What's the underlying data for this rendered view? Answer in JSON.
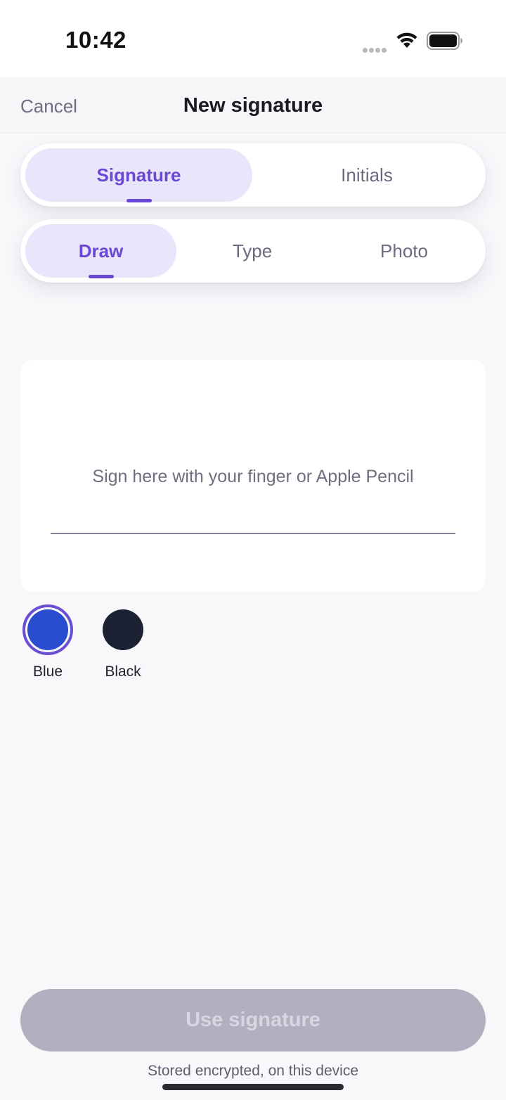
{
  "status_bar": {
    "time": "10:42",
    "icons": [
      "signal-icon",
      "wifi-icon",
      "battery-icon"
    ]
  },
  "nav": {
    "cancel_label": "Cancel",
    "title": "New signature"
  },
  "kind_tabs": {
    "items": [
      {
        "label": "Signature",
        "selected": true
      },
      {
        "label": "Initials",
        "selected": false
      }
    ]
  },
  "method_tabs": {
    "items": [
      {
        "label": "Draw",
        "selected": true
      },
      {
        "label": "Type",
        "selected": false
      },
      {
        "label": "Photo",
        "selected": false
      }
    ]
  },
  "sign_pad": {
    "hint": "Sign here with your finger or Apple Pencil"
  },
  "ink_colors": {
    "items": [
      {
        "label": "Blue",
        "color": "#2a4dd0",
        "selected": true
      },
      {
        "label": "Black",
        "color": "#1c2233",
        "selected": false
      }
    ]
  },
  "actions": {
    "use_label": "Use signature",
    "enabled": false
  },
  "footnote": "Stored encrypted, on this device",
  "colors": {
    "accent": "#6b47d6",
    "button_disabled": "#b2b0bf"
  }
}
